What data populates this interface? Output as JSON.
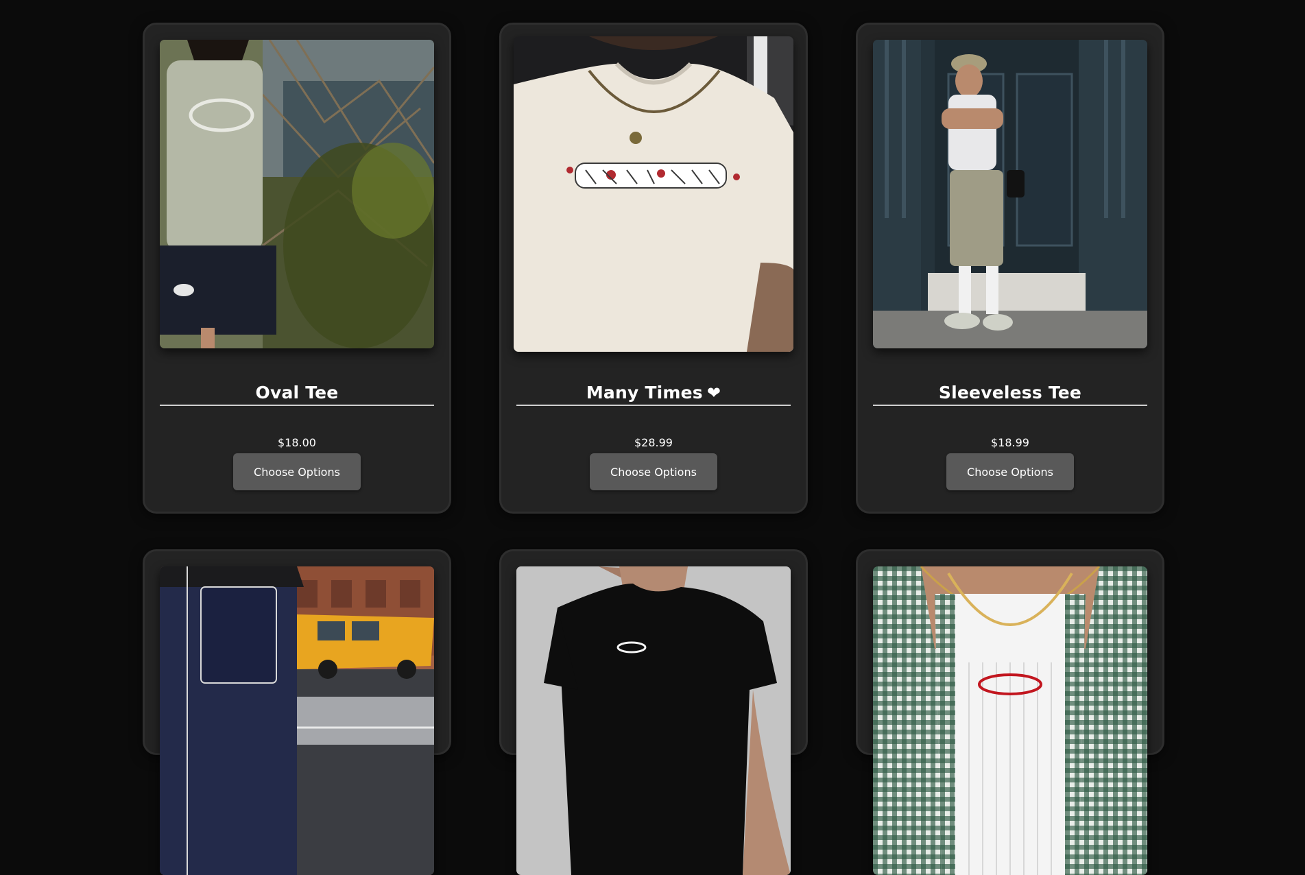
{
  "products": [
    {
      "title": "Oval Tee",
      "price": "$18.00",
      "button": "Choose Options",
      "image_icon": "oval-tee-photo"
    },
    {
      "title": "Many Times",
      "title_icon": "heart-icon",
      "heart": "❤",
      "price": "$28.99",
      "button": "Choose Options",
      "image_icon": "many-times-tee-photo"
    },
    {
      "title": "Sleeveless Tee",
      "price": "$18.99",
      "button": "Choose Options",
      "image_icon": "sleeveless-tee-photo"
    },
    {
      "image_icon": "carpenter-pants-photo"
    },
    {
      "image_icon": "black-baby-tee-photo"
    },
    {
      "image_icon": "ribbed-tank-photo"
    }
  ],
  "colors": {
    "page_background": "#0b0b0b",
    "card_background": "#232323",
    "button_background": "#595959",
    "text": "#ffffff",
    "heart": "#ffffff"
  }
}
